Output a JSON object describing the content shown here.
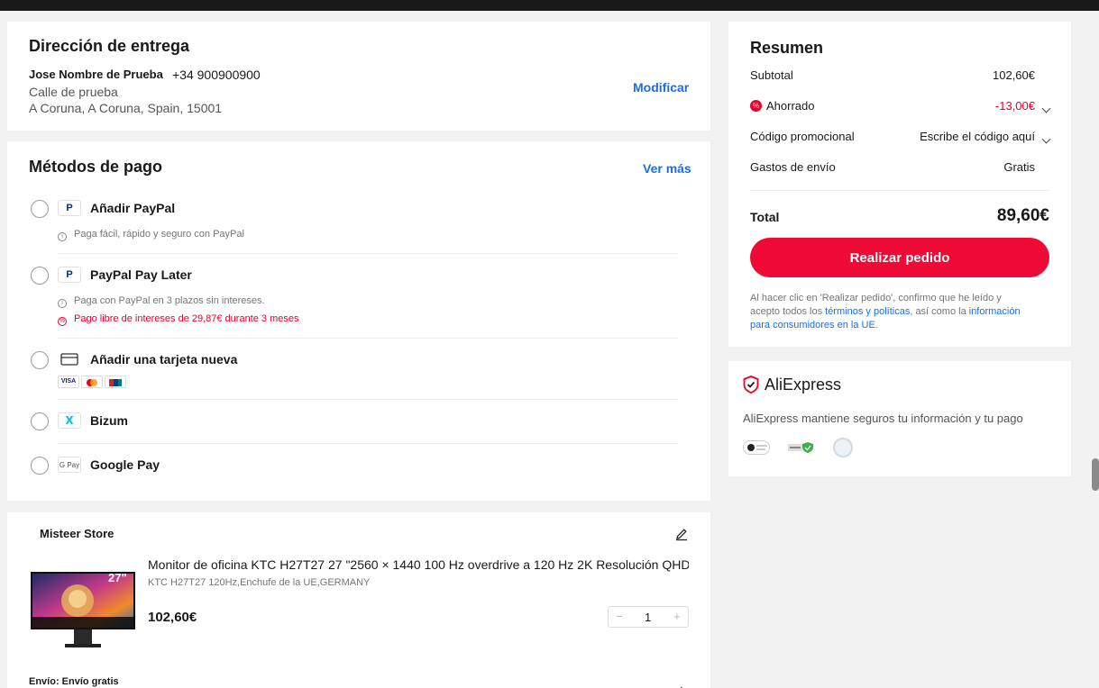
{
  "address": {
    "title": "Dirección de entrega",
    "name": "Jose Nombre de Prueba",
    "phone": "+34 900900900",
    "street": "Calle de prueba",
    "city": "A Coruna, A Coruna, Spain, 15001",
    "modify_label": "Modificar"
  },
  "payment": {
    "title": "Métodos de pago",
    "more_label": "Ver más",
    "methods": [
      {
        "label": "Añadir PayPal",
        "icon": "paypal-icon",
        "note": "Paga fácil, rápido y seguro con PayPal"
      },
      {
        "label": "PayPal Pay Later",
        "icon": "paypal-icon",
        "note": "Paga con PayPal en 3 plazos sin intereses.",
        "promo": "Pago libre de intereses de 29,87€ durante 3 meses"
      },
      {
        "label": "Añadir una tarjeta nueva",
        "icon": "credit-card-icon",
        "cards": [
          "VISA",
          "mastercard",
          "UnionPay"
        ]
      },
      {
        "label": "Bizum",
        "icon": "bizum-icon"
      },
      {
        "label": "Google Pay",
        "icon": "google-pay-icon",
        "icon_text": "G Pay"
      }
    ]
  },
  "store": {
    "name": "Misteer Store",
    "product_title": "Monitor de oficina KTC H27T27 27 \"2560 × 1440 100 Hz overdrive a 120 Hz 2K Resolución QHD",
    "variant": "KTC H27T27 120Hz,Enchufe de la UE,GERMANY",
    "price": "102,60€",
    "quantity": "1",
    "minus": "−",
    "plus": "+",
    "image_badge": "27\"",
    "shipping_label": "Envío: Envío gratis"
  },
  "summary": {
    "title": "Resumen",
    "subtotal_label": "Subtotal",
    "subtotal_value": "102,60€",
    "saved_label": "Ahorrado",
    "saved_value": "-13,00€",
    "promo_label": "Código promocional",
    "promo_value": "Escribe el código aquí",
    "shipping_label": "Gastos de envío",
    "shipping_value": "Gratis",
    "total_label": "Total",
    "total_value": "89,60€",
    "order_button": "Realizar pedido",
    "legal_1": "Al hacer clic en 'Realizar pedido', confirmo que he leído y",
    "legal_2a": "acepto todos los ",
    "legal_terms": "términos y políticas",
    "legal_2b": ", así como la ",
    "legal_info": "información",
    "legal_3": "para consumidores en la UE",
    "legal_3_end": "."
  },
  "trust": {
    "brand": "AliExpress",
    "message": "AliExpress mantiene seguros tu información y tu pago"
  },
  "colors": {
    "accent": "#ee0a34",
    "link": "#1a6fe0",
    "price_red": "#e8002d"
  }
}
